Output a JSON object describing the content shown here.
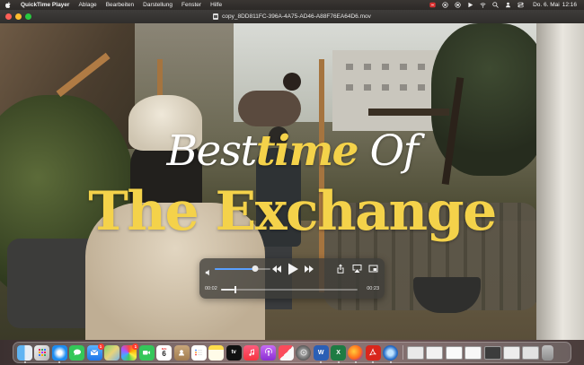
{
  "menubar": {
    "app_name": "QuickTime Player",
    "menus": [
      "Ablage",
      "Bearbeiten",
      "Darstellung",
      "Fenster",
      "Hilfe"
    ],
    "clock_date": "Do. 6. Mai",
    "clock_time": "12:16"
  },
  "window": {
    "title": "copy_8DD811FC-396A-4A75-AD46-A88F76EA64D6.mov"
  },
  "video": {
    "title_line1_part1": "Best",
    "title_line1_accent": "time",
    "title_line1_part2": " Of",
    "title_line2": "The Exchange"
  },
  "controls": {
    "current_time": "00:02",
    "remaining_time": "00:23",
    "volume_level": 0.72,
    "playback_progress": 0.1
  },
  "dock": {
    "icons": [
      "finder-icon",
      "launchpad-icon",
      "safari-icon",
      "messages-icon",
      "mail-icon",
      "maps-icon",
      "photos-icon",
      "facetime-icon",
      "calendar-icon",
      "contacts-icon",
      "reminders-icon",
      "notes-icon",
      "tv-icon",
      "music-icon",
      "podcasts-icon",
      "news-icon",
      "system-preferences-icon",
      "word-icon",
      "excel-icon",
      "firefox-icon",
      "acrobat-icon",
      "quicktime-icon"
    ],
    "calendar_day": "6",
    "mail_badge": "1",
    "photos_badge": "1",
    "tv_label": "tv"
  },
  "colors": {
    "title_yellow": "#f4d24a",
    "accent_blue": "#5aa0ff"
  }
}
